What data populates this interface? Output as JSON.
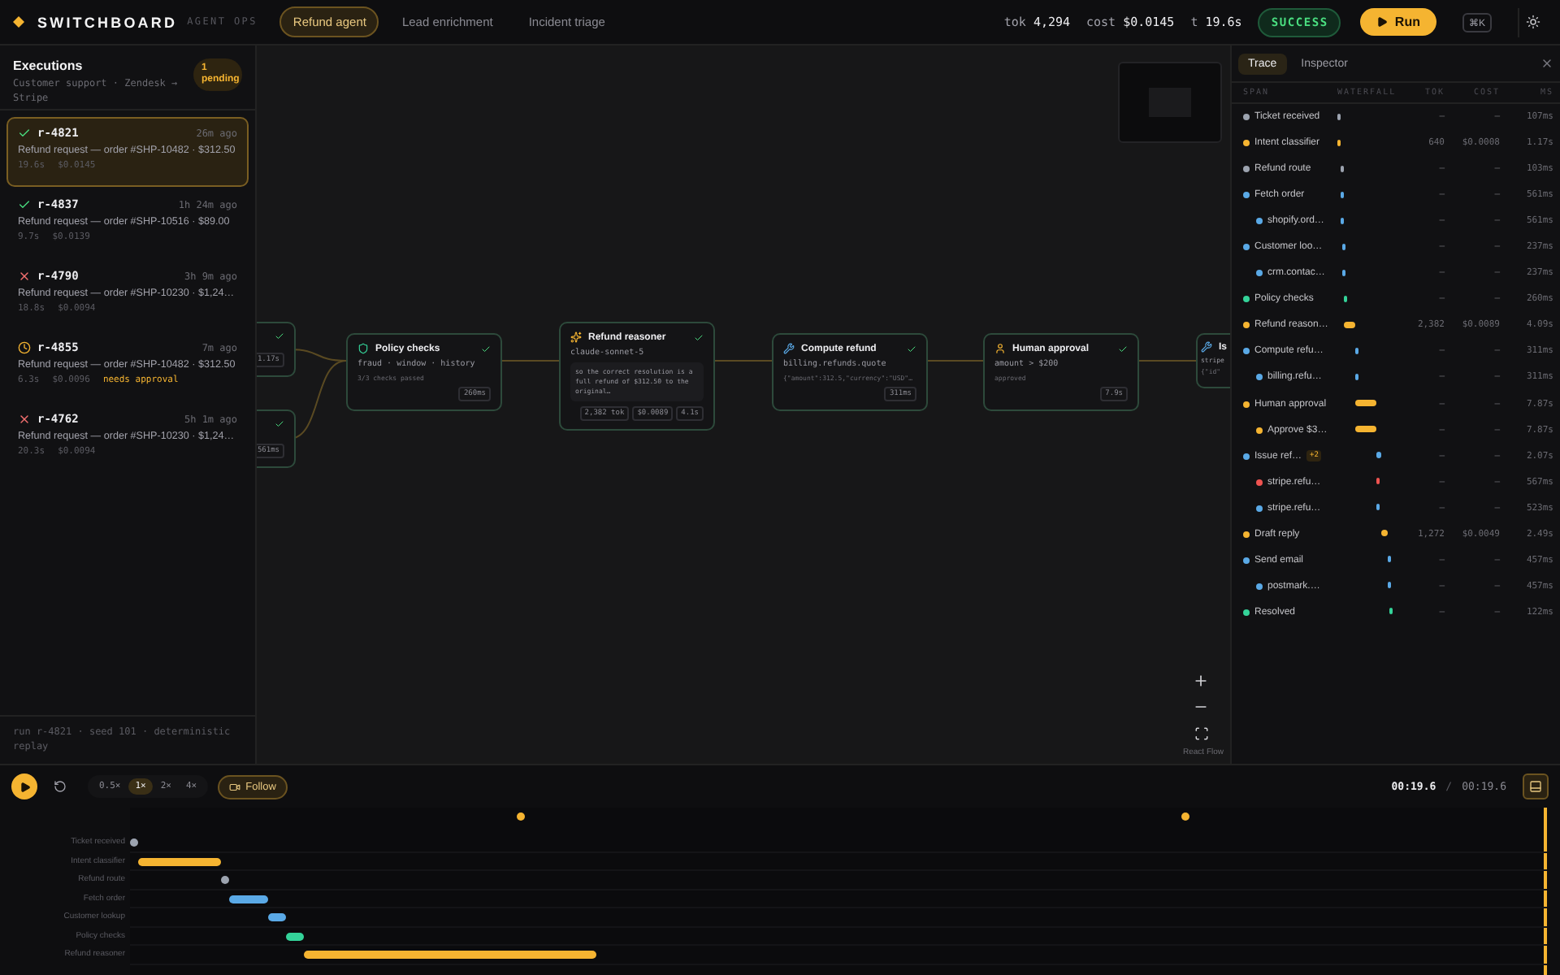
{
  "topbar": {
    "brand": "SWITCHBOARD",
    "tagline": "AGENT OPS",
    "tabs": [
      {
        "label": "Refund agent",
        "selected": true
      },
      {
        "label": "Lead enrichment",
        "selected": false
      },
      {
        "label": "Incident triage",
        "selected": false
      }
    ],
    "stats": [
      {
        "label": "tok",
        "value": "4,294"
      },
      {
        "label": "cost",
        "value": "$0.0145"
      },
      {
        "label": "t",
        "value": "19.6s"
      }
    ],
    "status": {
      "label": "SUCCESS",
      "kind": "success"
    },
    "run_button": "Run",
    "shortcut": "⌘K"
  },
  "executions": {
    "title": "Executions",
    "subtitle": "Customer support · Zendesk → Stripe",
    "pending_badge": "1 pending",
    "items": [
      {
        "kind": "success",
        "id": "r-4821",
        "time": "26m ago",
        "title": "Refund request — order #SHP-10482 · $312.50",
        "duration": "19.6s",
        "cost": "$0.0145",
        "selected": true
      },
      {
        "kind": "success",
        "id": "r-4837",
        "time": "1h 24m ago",
        "title": "Refund request — order #SHP-10516 · $89.00",
        "duration": "9.7s",
        "cost": "$0.0139",
        "selected": false
      },
      {
        "kind": "failed",
        "id": "r-4790",
        "time": "3h 9m ago",
        "title": "Refund request — order #SHP-10230 · $1,24…",
        "duration": "18.8s",
        "cost": "$0.0094",
        "selected": false
      },
      {
        "kind": "pending",
        "id": "r-4855",
        "time": "7m ago",
        "title": "Refund request — order #SHP-10482 · $312.50",
        "duration": "6.3s",
        "cost": "$0.0096",
        "tag": "needs approval",
        "selected": false
      },
      {
        "kind": "failed",
        "id": "r-4762",
        "time": "5h 1m ago",
        "title": "Refund request — order #SHP-10230 · $1,24…",
        "duration": "20.3s",
        "cost": "$0.0094",
        "selected": false
      }
    ],
    "footer": "run r-4821 · seed 101 · deterministic replay"
  },
  "canvas": {
    "nodes": [
      {
        "kind": "partial",
        "checked": true,
        "badge": "1.17s"
      },
      {
        "kind": "partial",
        "checked": true,
        "badge": "561ms"
      },
      {
        "kind": "full",
        "title": "Policy checks",
        "subtitle": "fraud · window · history",
        "body": "3/3 checks passed",
        "badges": [
          "260ms"
        ],
        "checked": true
      },
      {
        "kind": "llm",
        "title": "Refund reasoner",
        "subtitle": "claude-sonnet-5",
        "body": "so the correct resolution is a full refund of $312.50 to the original…",
        "badges": [
          "2,382 tok",
          "$0.0089",
          "4.1s"
        ],
        "checked": true
      },
      {
        "kind": "full",
        "title": "Compute refund",
        "subtitle": "billing.refunds.quote",
        "body": "{\"amount\":312.5,\"currency\":\"USD\"…",
        "badges": [
          "311ms"
        ],
        "checked": true
      },
      {
        "kind": "full",
        "title": "Human approval",
        "subtitle": "amount > $200",
        "body": "approved",
        "badges": [
          "7.9s"
        ],
        "checked": true
      },
      {
        "kind": "edge",
        "title": "Is",
        "subtitle": "stripe",
        "body": "{\"id\""
      }
    ],
    "attribution": "React Flow"
  },
  "trace": {
    "tabs": [
      {
        "label": "Trace",
        "selected": true
      },
      {
        "label": "Inspector",
        "selected": false
      }
    ],
    "columns": [
      "SPAN",
      "WATERFALL",
      "TOK",
      "COST",
      "MS"
    ],
    "spans": [
      {
        "name": "Ticket received",
        "color": "#9ca3af",
        "tok": "—",
        "cost": "—",
        "ms": "107ms"
      },
      {
        "name": "Intent classifier",
        "color": "#f5b431",
        "tok": "640",
        "cost": "$0.0008",
        "ms": "1.17s"
      },
      {
        "name": "Refund route",
        "color": "#9ca3af",
        "tok": "—",
        "cost": "—",
        "ms": "103ms"
      },
      {
        "name": "Fetch order",
        "color": "#5aa9e6",
        "tok": "—",
        "cost": "—",
        "ms": "561ms",
        "children": [
          {
            "name": "shopify.ord…",
            "color": "#5aa9e6",
            "tok": "—",
            "cost": "—",
            "ms": "561ms"
          }
        ]
      },
      {
        "name": "Customer loo…",
        "color": "#5aa9e6",
        "tok": "—",
        "cost": "—",
        "ms": "237ms",
        "children": [
          {
            "name": "crm.contac…",
            "color": "#5aa9e6",
            "tok": "—",
            "cost": "—",
            "ms": "237ms"
          }
        ]
      },
      {
        "name": "Policy checks",
        "color": "#34d399",
        "tok": "—",
        "cost": "—",
        "ms": "260ms"
      },
      {
        "name": "Refund reason…",
        "color": "#f5b431",
        "tok": "2,382",
        "cost": "$0.0089",
        "ms": "4.09s"
      },
      {
        "name": "Compute refu…",
        "color": "#5aa9e6",
        "tok": "—",
        "cost": "—",
        "ms": "311ms",
        "children": [
          {
            "name": "billing.refu…",
            "color": "#5aa9e6",
            "tok": "—",
            "cost": "—",
            "ms": "311ms"
          }
        ]
      },
      {
        "name": "Human approval",
        "color": "#f5b431",
        "tok": "—",
        "cost": "—",
        "ms": "7.87s",
        "children": [
          {
            "name": "Approve $3…",
            "color": "#f5b431",
            "tok": "—",
            "cost": "—",
            "ms": "7.87s"
          }
        ]
      },
      {
        "name": "Issue ref…",
        "color": "#5aa9e6",
        "badge": "+2",
        "tok": "—",
        "cost": "—",
        "ms": "2.07s",
        "children": [
          {
            "name": "stripe.refu…",
            "color": "#ef5350",
            "tok": "—",
            "cost": "—",
            "ms": "567ms"
          },
          {
            "name": "stripe.refu…",
            "color": "#5aa9e6",
            "tok": "—",
            "cost": "—",
            "ms": "523ms"
          }
        ]
      },
      {
        "name": "Draft reply",
        "color": "#f5b431",
        "tok": "1,272",
        "cost": "$0.0049",
        "ms": "2.49s"
      },
      {
        "name": "Send email",
        "color": "#5aa9e6",
        "tok": "—",
        "cost": "—",
        "ms": "457ms",
        "children": [
          {
            "name": "postmark.…",
            "color": "#5aa9e6",
            "tok": "—",
            "cost": "—",
            "ms": "457ms"
          }
        ]
      },
      {
        "name": "Resolved",
        "color": "#34d399",
        "tok": "—",
        "cost": "—",
        "ms": "122ms"
      }
    ]
  },
  "player": {
    "speeds": [
      {
        "label": "0.5×",
        "selected": false
      },
      {
        "label": "1×",
        "selected": true
      },
      {
        "label": "2×",
        "selected": false
      },
      {
        "label": "4×",
        "selected": false
      }
    ],
    "follow": {
      "label": "Follow",
      "on": true
    },
    "time": "00:19.6",
    "separator": "/",
    "total": "00:19.6",
    "markers": [
      {
        "level": 0.279
      },
      {
        "level": 0.748
      }
    ],
    "playhead": {
      "level": 1
    },
    "rows": [
      {
        "label": "Ticket received",
        "color": "#9ca3af"
      },
      {
        "label": "Intent classifier",
        "color": "#f5b431"
      },
      {
        "label": "Refund route",
        "color": "#9ca3af"
      },
      {
        "label": "Fetch order",
        "color": "#5aa9e6"
      },
      {
        "label": "Customer lookup",
        "color": "#5aa9e6"
      },
      {
        "label": "Policy checks",
        "color": "#34d399"
      },
      {
        "label": "Refund reasoner",
        "color": "#f5b431"
      }
    ]
  }
}
